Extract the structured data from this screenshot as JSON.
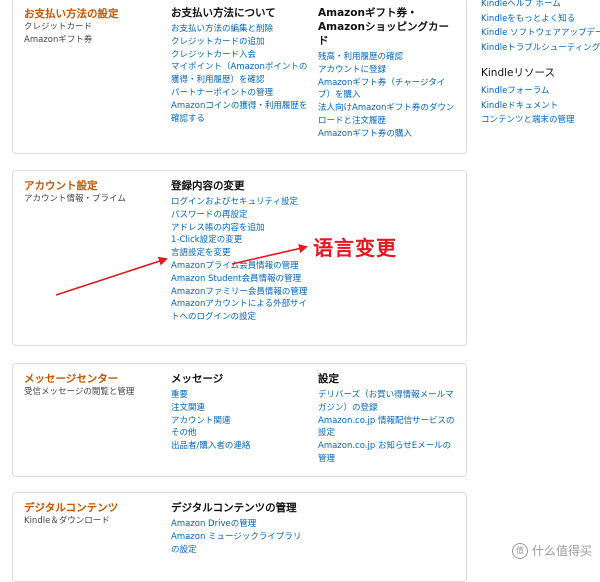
{
  "accent_link": "#0066c0",
  "accent_title": "#c45500",
  "annotation_color": "#e4161e",
  "payments": {
    "title": "お支払い方法の設定",
    "subtitles": [
      "クレジットカード",
      "Amazonギフト券"
    ],
    "col1": {
      "heading": "お支払い方法について",
      "links": [
        "お支払い方法の編集と削除",
        "クレジットカードの追加",
        "クレジットカード入会",
        "マイポイント（Amazonポイントの獲得・利用履歴）を確認",
        "パートナーポイントの管理",
        "Amazonコインの獲得・利用履歴を確認する"
      ]
    },
    "col2": {
      "heading": "Amazonギフト券・Amazonショッピングカード",
      "links": [
        "残高・利用履歴の確認",
        "アカウントに登録",
        "Amazonギフト券（チャージタイプ）を購入",
        "法人向けAmazonギフト券のダウンロードと注文履歴",
        "Amazonギフト券の購入"
      ]
    }
  },
  "account": {
    "title": "アカウント設定",
    "subtitle": "アカウント情報・プライム",
    "col1": {
      "heading": "登録内容の変更",
      "links": [
        "ログインおよびセキュリティ設定",
        "パスワードの再設定",
        "アドレス帳の内容を追加",
        "1-Click設定の変更",
        "言語設定を変更",
        "Amazonプライム会員情報の管理",
        "Amazon Student会員情報の管理",
        "Amazonファミリー会員情報の管理",
        "Amazonアカウントによる外部サイトへのログインの設定"
      ]
    }
  },
  "messages": {
    "title": "メッセージセンター",
    "subtitle": "受信メッセージの閲覧と管理",
    "col1": {
      "heading": "メッセージ",
      "links": [
        "重要",
        "注文関連",
        "アカウント関連",
        "その他",
        "出品者/購入者の連絡"
      ]
    },
    "col2": {
      "heading": "設定",
      "links": [
        "デリバーズ（お買い得情報メールマガジン）の登録",
        "Amazon.co.jp 情報配信サービスの設定",
        "Amazon.co.jp お知らせEメールの管理"
      ]
    }
  },
  "digital": {
    "title": "デジタルコンテンツ",
    "subtitle": "Kindle＆ダウンロード",
    "col1": {
      "heading": "デジタルコンテンツの管理",
      "links": [
        "Amazon Driveの管理",
        "Amazon ミュージックライブラリの設定"
      ]
    }
  },
  "kindle_panel": {
    "top_links": [
      "Kindleヘルプ ホーム",
      "Kindleをもっとよく知る",
      "Kindle ソフトウェアアップデート",
      "Kindleトラブルシューティング"
    ],
    "resources_heading": "Kindleリソース",
    "resource_links": [
      "Kindleフォーラム",
      "Kindleドキュメント",
      "コンテンツと端末の管理"
    ]
  },
  "annotation": {
    "text": "语言变更"
  },
  "watermark": {
    "icon_glyph": "值",
    "text": "什么值得买"
  }
}
